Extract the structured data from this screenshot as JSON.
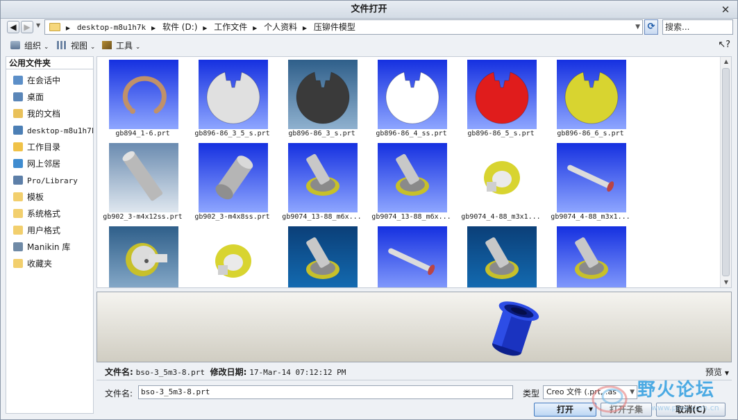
{
  "window": {
    "title": "文件打开"
  },
  "address": {
    "crumbs": [
      "desktop-m8u1h7k",
      "软件 (D:)",
      "工作文件",
      "个人资料",
      "压铆件模型"
    ],
    "search_placeholder": "搜索..."
  },
  "toolbar": {
    "organize": "组织",
    "view": "视图",
    "tools": "工具"
  },
  "sidebar": {
    "header": "公用文件夹",
    "items": [
      {
        "label": "在会话中",
        "icon": "monitor-icon"
      },
      {
        "label": "桌面",
        "icon": "desktop-icon"
      },
      {
        "label": "我的文档",
        "icon": "documents-icon"
      },
      {
        "label": "desktop-m8u1h7k",
        "icon": "computer-icon"
      },
      {
        "label": "工作目录",
        "icon": "work-folder-icon"
      },
      {
        "label": "网上邻居",
        "icon": "network-icon"
      },
      {
        "label": "Pro/Library",
        "icon": "library-icon"
      },
      {
        "label": "模板",
        "icon": "folder-icon"
      },
      {
        "label": "系统格式",
        "icon": "folder-icon"
      },
      {
        "label": "用户格式",
        "icon": "folder-icon"
      },
      {
        "label": "Manikin 库",
        "icon": "manikin-icon"
      },
      {
        "label": "收藏夹",
        "icon": "favorites-icon"
      }
    ]
  },
  "files": [
    {
      "name": "gb894_1-6.prt",
      "part": "ring-open",
      "bg": "blue",
      "color": "#c0916a"
    },
    {
      "name": "gb896-86_3_5_s.prt",
      "part": "eclip",
      "bg": "blue",
      "color": "#e0e0e0"
    },
    {
      "name": "gb896-86_3_s.prt",
      "part": "eclip",
      "bg": "steel",
      "color": "#3a3a3a"
    },
    {
      "name": "gb896-86_4_ss.prt",
      "part": "eclip",
      "bg": "blue",
      "color": "#ffffff"
    },
    {
      "name": "gb896-86_5_s.prt",
      "part": "eclip",
      "bg": "blue",
      "color": "#e01c1c"
    },
    {
      "name": "gb896-86_6_s.prt",
      "part": "eclip",
      "bg": "blue",
      "color": "#d8d430"
    },
    {
      "name": "gb902_3-m4x12ss.prt",
      "part": "pin",
      "bg": "light",
      "color": "#b9b9b9"
    },
    {
      "name": "gb902_3-m4x8ss.prt",
      "part": "stud",
      "bg": "blue",
      "color": "#b5b5b5"
    },
    {
      "name": "gb9074_13-88_m6x...",
      "part": "bolt-washer",
      "bg": "blue",
      "color": "#c8c8c8"
    },
    {
      "name": "gb9074_13-88_m6x...",
      "part": "bolt-washer",
      "bg": "blue",
      "color": "#c8c8c8"
    },
    {
      "name": "gb9074_4-88_m3x1...",
      "part": "washer-top",
      "bg": "white",
      "color": "#d8d430"
    },
    {
      "name": "gb9074_4-88_m3x1...",
      "part": "long-pin",
      "bg": "blue",
      "color": "#dcdcdc"
    },
    {
      "name": "",
      "part": "bolt-head",
      "bg": "steel",
      "color": "#dcdcdc"
    },
    {
      "name": "",
      "part": "washer-top",
      "bg": "white",
      "color": "#d8d430"
    },
    {
      "name": "",
      "part": "bolt-washer",
      "bg": "navy",
      "color": "#c8c8c8"
    },
    {
      "name": "",
      "part": "long-pin",
      "bg": "blue",
      "color": "#dcdcdc"
    },
    {
      "name": "",
      "part": "bolt-washer",
      "bg": "navy",
      "color": "#c8c8c8"
    },
    {
      "name": "",
      "part": "bolt-washer",
      "bg": "blue",
      "color": "#c8c8c8"
    }
  ],
  "preview": {
    "model": "blue-flanged-bushing",
    "color": "#1f3fd0"
  },
  "info": {
    "filename_label": "文件名:",
    "filename_value": "bso-3_5m3-8.prt",
    "modified_label": "修改日期:",
    "modified_value": "17-Mar-14 07:12:12 PM",
    "preview_toggle": "预览"
  },
  "bottom": {
    "filename_label": "文件名:",
    "filename_value": "bso-3_5m3-8.prt",
    "type_label": "类型",
    "type_value": "Creo 文件 (.prt, .as",
    "open_button": "打开",
    "open_subset_button": "打开子集",
    "cancel_button": "取消(C)"
  },
  "watermark": {
    "text": "野火论坛",
    "url": "www.proe.com.cn"
  }
}
